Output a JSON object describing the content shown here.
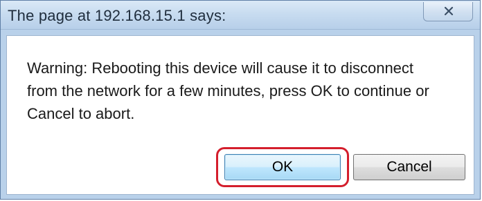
{
  "dialog": {
    "title": "The page at 192.168.15.1 says:",
    "message": "Warning: Rebooting this device will cause it to disconnect\nfrom the network for a few minutes, press OK to continue or\nCancel to abort.",
    "close_icon": "close-icon",
    "buttons": {
      "ok_label": "OK",
      "cancel_label": "Cancel"
    },
    "highlight_color": "#d41e2c"
  }
}
